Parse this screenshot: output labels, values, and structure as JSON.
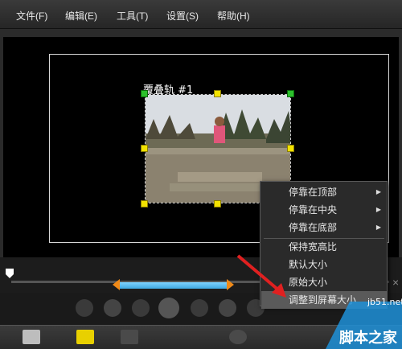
{
  "menu": [
    "文件(F)",
    "编辑(E)",
    "工具(T)",
    "设置(S)",
    "帮助(H)"
  ],
  "overlay_label": "覆叠轨 #1",
  "context_menu": [
    {
      "label": "停靠在顶部",
      "submenu": true
    },
    {
      "label": "停靠在中央",
      "submenu": true
    },
    {
      "label": "停靠在底部",
      "submenu": true
    },
    {
      "label": "保持宽高比",
      "submenu": false
    },
    {
      "label": "默认大小",
      "submenu": false
    },
    {
      "label": "原始大小",
      "submenu": false
    },
    {
      "label": "调整到屏幕大小",
      "submenu": false
    }
  ],
  "watermark": {
    "url": "jb51.net",
    "text": "脚本之家"
  },
  "colors": {
    "handle": "#f2e200",
    "range": "#5bbcf0",
    "arrow": "#e02020"
  }
}
